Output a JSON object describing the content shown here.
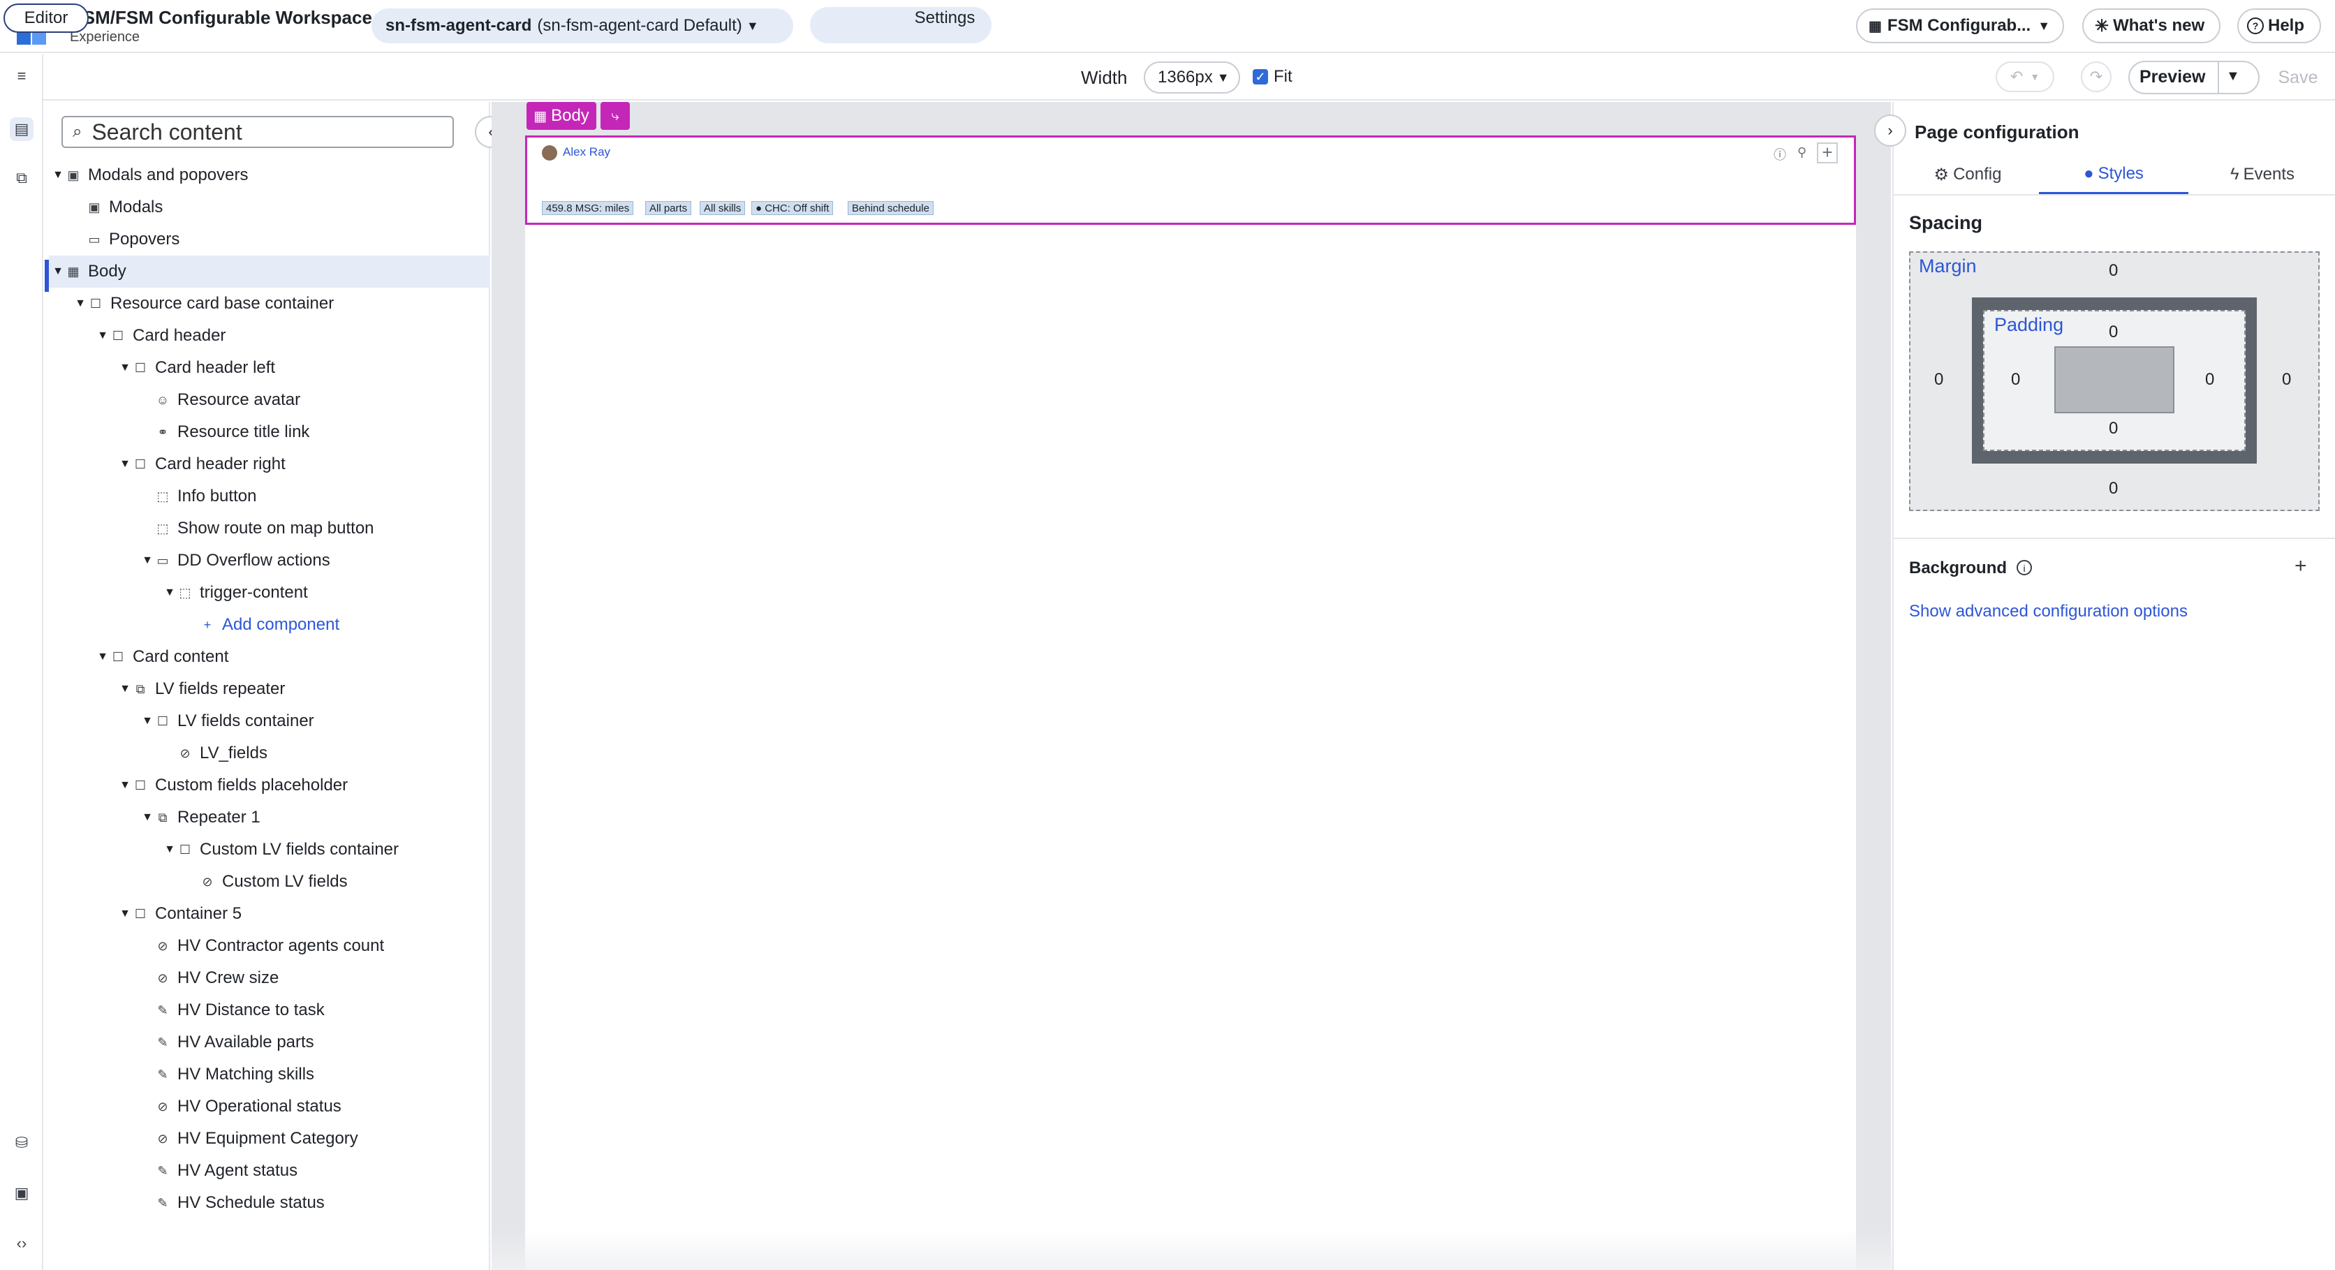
{
  "header": {
    "app_title": "CSM/FSM Configurable Workspace",
    "app_subtitle": "Experience",
    "page_selector": {
      "name": "sn-fsm-agent-card",
      "variant": "(sn-fsm-agent-card Default)"
    },
    "modes": {
      "editor": "Editor",
      "settings": "Settings",
      "active": "Editor"
    },
    "experience_dropdown": "FSM Configurab...",
    "whats_new": "What's new",
    "help": "Help"
  },
  "toolbar": {
    "width_label": "Width",
    "width_value": "1366px",
    "fit_label": "Fit",
    "fit_checked": true,
    "preview_label": "Preview",
    "save_label": "Save"
  },
  "tree": {
    "search_placeholder": "Search content",
    "items": [
      {
        "label": "Modals and popovers",
        "icon": "modal-icon"
      },
      {
        "label": "Modals",
        "icon": "modal-icon"
      },
      {
        "label": "Popovers",
        "icon": "popover-icon"
      },
      {
        "label": "Body",
        "icon": "layout-icon",
        "selected": true
      },
      {
        "label": "Resource card base container",
        "icon": "container-icon"
      },
      {
        "label": "Card header",
        "icon": "container-icon"
      },
      {
        "label": "Card header left",
        "icon": "container-icon"
      },
      {
        "label": "Resource avatar",
        "icon": "avatar-icon"
      },
      {
        "label": "Resource title link",
        "icon": "link-icon"
      },
      {
        "label": "Card header right",
        "icon": "container-icon"
      },
      {
        "label": "Info button",
        "icon": "button-icon"
      },
      {
        "label": "Show route on map button",
        "icon": "button-icon"
      },
      {
        "label": "DD Overflow actions",
        "icon": "dropdown-icon"
      },
      {
        "label": "trigger-content",
        "icon": "slot-icon"
      },
      {
        "label": "Add component",
        "icon": "plus-icon"
      },
      {
        "label": "Card content",
        "icon": "container-icon"
      },
      {
        "label": "LV fields repeater",
        "icon": "repeater-icon"
      },
      {
        "label": "LV fields container",
        "icon": "container-icon"
      },
      {
        "label": "LV_fields",
        "icon": "hidden-icon"
      },
      {
        "label": "Custom fields placeholder",
        "icon": "container-icon"
      },
      {
        "label": "Repeater 1",
        "icon": "repeater-icon"
      },
      {
        "label": "Custom LV fields container",
        "icon": "container-icon"
      },
      {
        "label": "Custom LV fields",
        "icon": "hidden-icon"
      },
      {
        "label": "Container 5",
        "icon": "container-icon"
      },
      {
        "label": "HV Contractor agents count",
        "icon": "hidden-icon"
      },
      {
        "label": "HV Crew size",
        "icon": "hidden-icon"
      },
      {
        "label": "HV Distance to task",
        "icon": "highlight-icon"
      },
      {
        "label": "HV Available parts",
        "icon": "highlight-icon"
      },
      {
        "label": "HV Matching skills",
        "icon": "highlight-icon"
      },
      {
        "label": "HV Operational status",
        "icon": "hidden-icon"
      },
      {
        "label": "HV Equipment Category",
        "icon": "hidden-icon"
      },
      {
        "label": "HV Agent status",
        "icon": "highlight-icon"
      },
      {
        "label": "HV Schedule status",
        "icon": "highlight-icon"
      }
    ]
  },
  "canvas": {
    "body_tag": "Body",
    "agent_name": "Alex Ray",
    "chips": [
      "459.8 MSG: miles",
      "All parts",
      "All skills",
      "● CHC: Off shift",
      "Behind schedule"
    ]
  },
  "right_panel": {
    "title": "Page configuration",
    "tabs": [
      "Config",
      "Styles",
      "Events"
    ],
    "active_tab": "Styles",
    "spacing_title": "Spacing",
    "margin_label": "Margin",
    "padding_label": "Padding",
    "margin": {
      "top": "0",
      "right": "0",
      "bottom": "0",
      "left": "0"
    },
    "padding": {
      "top": "0",
      "right": "0",
      "bottom": "0",
      "left": "0"
    },
    "background_title": "Background",
    "advanced_link": "Show advanced configuration options"
  },
  "colors": {
    "accent": "#2d56d6",
    "selection_magenta": "#c427b8",
    "chip_bg": "#cfdff0",
    "canvas_bg": "#e3e5e8"
  }
}
